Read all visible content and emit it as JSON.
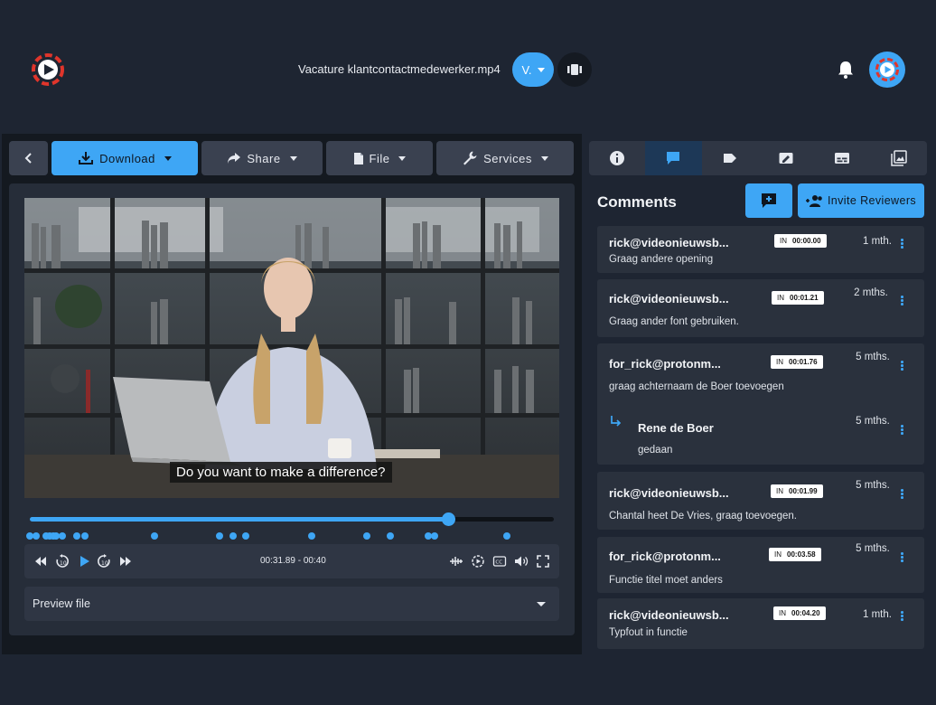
{
  "header": {
    "file_name": "Vacature klantcontactmedewerker.mp4",
    "version_label": "V.",
    "logo_icon": "play-logo-icon",
    "compare_icon": "compare-icon",
    "bell_icon": "bell-icon",
    "avatar_icon": "avatar-play-icon"
  },
  "toolbar": {
    "back_icon": "chevron-left-icon",
    "download_label": "Download",
    "share_label": "Share",
    "file_label": "File",
    "services_label": "Services"
  },
  "player": {
    "subtitle": "Do you want to make a difference?",
    "progress": 0.799,
    "time_readout": "00:31.89 - 00:40",
    "marker_times_sec": [
      0.0,
      1.21,
      1.76,
      1.99,
      3.58,
      4.2,
      0.5,
      1.5,
      2.5,
      9.5,
      14.5,
      15.5,
      16.5,
      21.5,
      25.7,
      27.5,
      30.4,
      30.9,
      36.4
    ],
    "preview_label": "Preview file",
    "accent_color": "#3ea6f5"
  },
  "sidebar_tabs": [
    "info-icon",
    "comment-icon",
    "tag-icon",
    "edit-icon",
    "subtitles-icon",
    "gallery-icon"
  ],
  "comments_panel": {
    "title": "Comments",
    "invite_label": "Invite Reviewers",
    "comments": [
      {
        "author": "rick@videonieuwsb...",
        "badge_in": "IN",
        "timecode": "00:00.00",
        "age": "1 mth.",
        "text": "Graag andere opening"
      },
      {
        "author": "rick@videonieuwsb...",
        "badge_in": "IN",
        "timecode": "00:01.21",
        "age": "2 mths.",
        "text": "Graag ander font gebruiken."
      },
      {
        "author": "for_rick@protonm...",
        "badge_in": "IN",
        "timecode": "00:01.76",
        "age": "5 mths.",
        "text": "graag achternaam de Boer toevoegen",
        "reply": {
          "author": "Rene de Boer",
          "age": "5 mths.",
          "text": "gedaan"
        }
      },
      {
        "author": "rick@videonieuwsb...",
        "badge_in": "IN",
        "timecode": "00:01.99",
        "age": "5 mths.",
        "text": "Chantal heet De Vries, graag toevoegen."
      },
      {
        "author": "for_rick@protonm...",
        "badge_in": "IN",
        "timecode": "00:03.58",
        "age": "5 mths.",
        "text": "Functie titel moet anders"
      },
      {
        "author": "rick@videonieuwsb...",
        "badge_in": "IN",
        "timecode": "00:04.20",
        "age": "1 mth.",
        "text": "Typfout in functie"
      }
    ]
  }
}
